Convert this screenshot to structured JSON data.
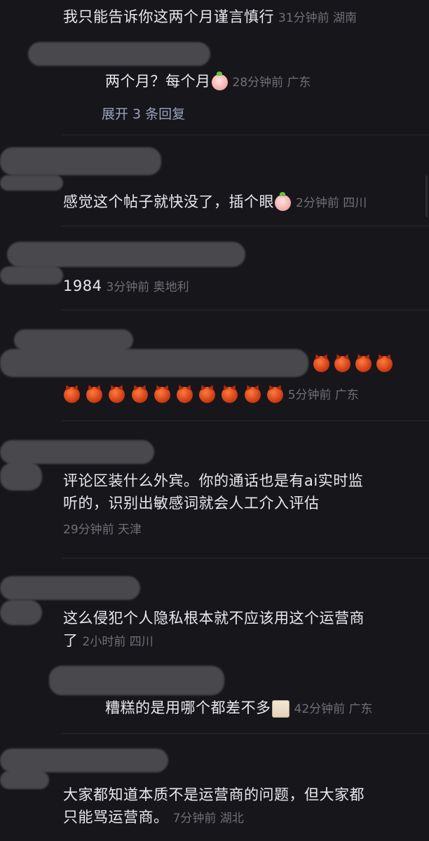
{
  "comments": [
    {
      "text": "我只能告诉你这两个月谨言慎行",
      "meta": "31分钟前 湖南"
    },
    {
      "text": "两个月？每个月",
      "meta": "28分钟前 广东",
      "expand": "展开 3 条回复"
    },
    {
      "text": "感觉这个帖子就快没了，插个眼",
      "meta": "2分钟前 四川"
    },
    {
      "text": "1984",
      "meta": "3分钟前 奥地利"
    },
    {
      "text": "",
      "meta": "5分钟前 广东"
    },
    {
      "line1": "评论区装什么外宾。你的通话也是有ai实时监",
      "line2": "听的，识别出敏感词就会人工介入评估",
      "meta": "29分钟前 天津"
    },
    {
      "line1": "这么侵犯个人隐私根本就不应该用这个运营商",
      "line2": "了",
      "meta": "2小时前 四川"
    },
    {
      "text": "糟糕的是用哪个都差不多",
      "meta": "42分钟前 广东"
    },
    {
      "line1": "大家都知道本质不是运营商的问题，但大家都",
      "line2": "只能骂运营商。",
      "meta": "7分钟前 湖北"
    }
  ],
  "emoji": {
    "peach": "peach-face-emoji",
    "devil": "angry-devil-emoji",
    "doc": "document-face-emoji"
  }
}
